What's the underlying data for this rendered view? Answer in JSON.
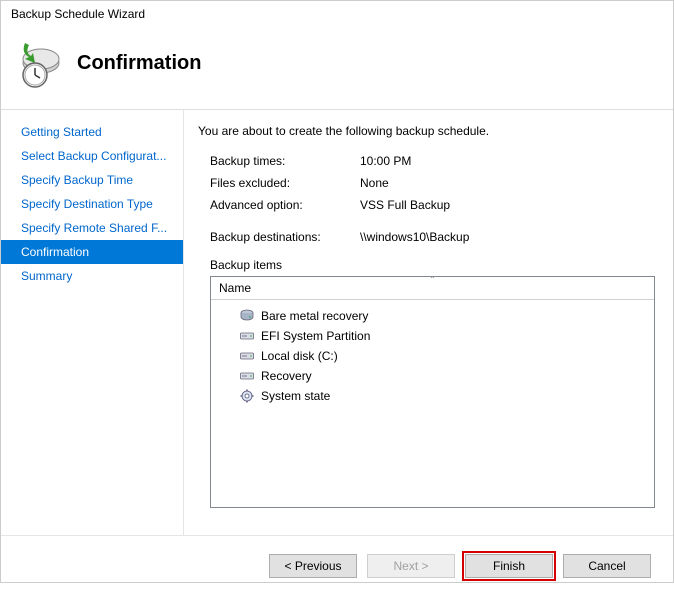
{
  "window": {
    "title": "Backup Schedule Wizard"
  },
  "header": {
    "title": "Confirmation"
  },
  "sidebar": {
    "items": [
      {
        "label": "Getting Started",
        "selected": false
      },
      {
        "label": "Select Backup Configurat...",
        "selected": false
      },
      {
        "label": "Specify Backup Time",
        "selected": false
      },
      {
        "label": "Specify Destination Type",
        "selected": false
      },
      {
        "label": "Specify Remote Shared F...",
        "selected": false
      },
      {
        "label": "Confirmation",
        "selected": true
      },
      {
        "label": "Summary",
        "selected": false
      }
    ]
  },
  "main": {
    "intro": "You are about to create the following backup schedule.",
    "rows": [
      {
        "label": "Backup times:",
        "value": "10:00 PM"
      },
      {
        "label": "Files excluded:",
        "value": "None"
      },
      {
        "label": "Advanced option:",
        "value": "VSS Full Backup"
      }
    ],
    "dest_label": "Backup destinations:",
    "dest_value": "\\\\windows10\\Backup",
    "items_label": "Backup items",
    "list": {
      "header": "Name",
      "items": [
        {
          "label": "Bare metal recovery",
          "icon": "disk"
        },
        {
          "label": "EFI System Partition",
          "icon": "drive"
        },
        {
          "label": "Local disk (C:)",
          "icon": "drive"
        },
        {
          "label": "Recovery",
          "icon": "drive"
        },
        {
          "label": "System state",
          "icon": "gear"
        }
      ]
    }
  },
  "footer": {
    "previous": "< Previous",
    "next": "Next >",
    "finish": "Finish",
    "cancel": "Cancel"
  }
}
